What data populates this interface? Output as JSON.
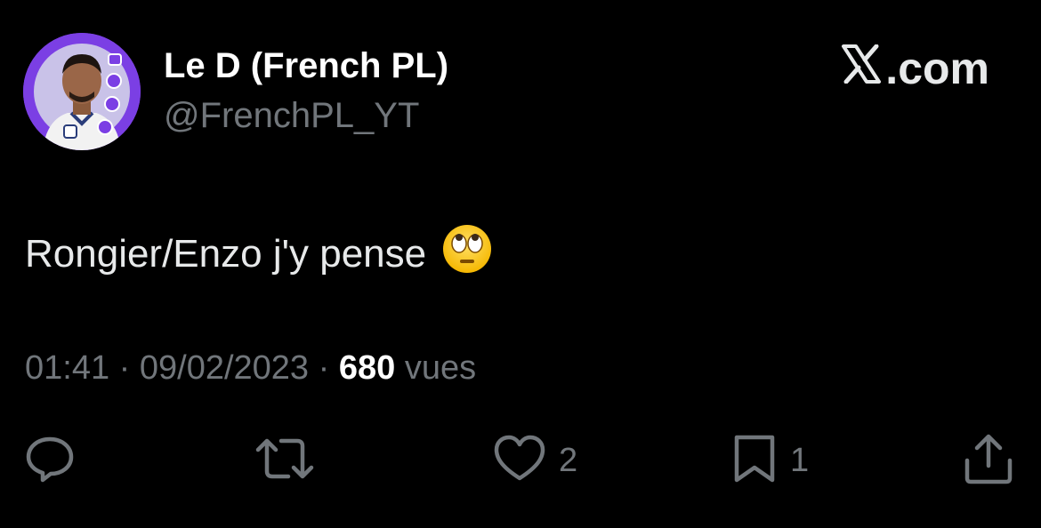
{
  "header": {
    "display_name": "Le D (French PL)",
    "handle": "@FrenchPL_YT",
    "brand_label": ".com",
    "brand_icon": "x-logo-icon"
  },
  "tweet": {
    "text": "Rongier/Enzo j'y pense",
    "emoji": "face-with-rolling-eyes"
  },
  "meta": {
    "time": "01:41",
    "separator": " · ",
    "date": "09/02/2023",
    "views_count": "680",
    "views_label": "vues"
  },
  "actions": {
    "reply": {
      "icon": "reply-icon",
      "count": ""
    },
    "retweet": {
      "icon": "retweet-icon",
      "count": ""
    },
    "like": {
      "icon": "heart-icon",
      "count": "2"
    },
    "bookmark": {
      "icon": "bookmark-icon",
      "count": "1"
    },
    "share": {
      "icon": "share-icon",
      "count": ""
    }
  },
  "colors": {
    "background": "#000000",
    "primary_text": "#e7e9ea",
    "secondary_text": "#71767b",
    "avatar_ring": "#7b3fe4"
  }
}
